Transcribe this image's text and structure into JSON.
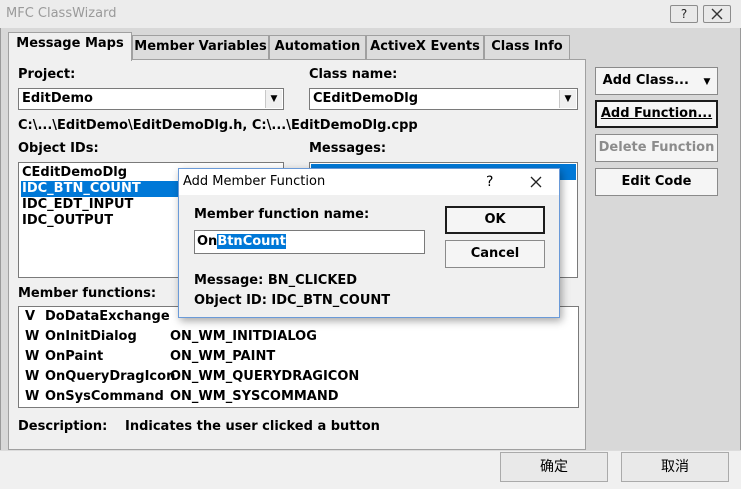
{
  "window": {
    "title": "MFC ClassWizard",
    "help_label": "?"
  },
  "tabs": [
    {
      "label": "Message Maps"
    },
    {
      "label": "Member Variables"
    },
    {
      "label": "Automation"
    },
    {
      "label": "ActiveX Events"
    },
    {
      "label": "Class Info"
    }
  ],
  "project": {
    "label": "Project:",
    "value": "EditDemo"
  },
  "class_name": {
    "label": "Class name:",
    "value": "CEditDemoDlg"
  },
  "path": "C:\\...\\EditDemo\\EditDemoDlg.h, C:\\...\\EditDemoDlg.cpp",
  "object_ids": {
    "label": "Object IDs:",
    "items": [
      "CEditDemoDlg",
      "IDC_BTN_COUNT",
      "IDC_EDT_INPUT",
      "IDC_OUTPUT"
    ]
  },
  "messages": {
    "label": "Messages:"
  },
  "member_functions": {
    "label": "Member functions:",
    "rows": [
      {
        "type": "V",
        "name": "DoDataExchange",
        "message": ""
      },
      {
        "type": "W",
        "name": "OnInitDialog",
        "message": "ON_WM_INITDIALOG"
      },
      {
        "type": "W",
        "name": "OnPaint",
        "message": "ON_WM_PAINT"
      },
      {
        "type": "W",
        "name": "OnQueryDragIcon",
        "message": "ON_WM_QUERYDRAGICON"
      },
      {
        "type": "W",
        "name": "OnSysCommand",
        "message": "ON_WM_SYSCOMMAND"
      }
    ]
  },
  "description": {
    "label": "Description:",
    "text": "Indicates the user clicked a button"
  },
  "buttons": {
    "add_class": "Add Class...",
    "add_function": "Add Function...",
    "delete_function": "Delete Function",
    "edit_code": "Edit Code",
    "ok_cn": "确定",
    "cancel_cn": "取消"
  },
  "dialog": {
    "title": "Add Member Function",
    "help": "?",
    "field_label": "Member function name:",
    "value_prefix": "On",
    "value_selected": "BtnCount",
    "message_line": "Message: BN_CLICKED",
    "object_line": "Object ID: IDC_BTN_COUNT",
    "ok": "OK",
    "cancel": "Cancel"
  },
  "colors": {
    "selection": "#0078d7",
    "window_bg": "#f0f0f0"
  }
}
